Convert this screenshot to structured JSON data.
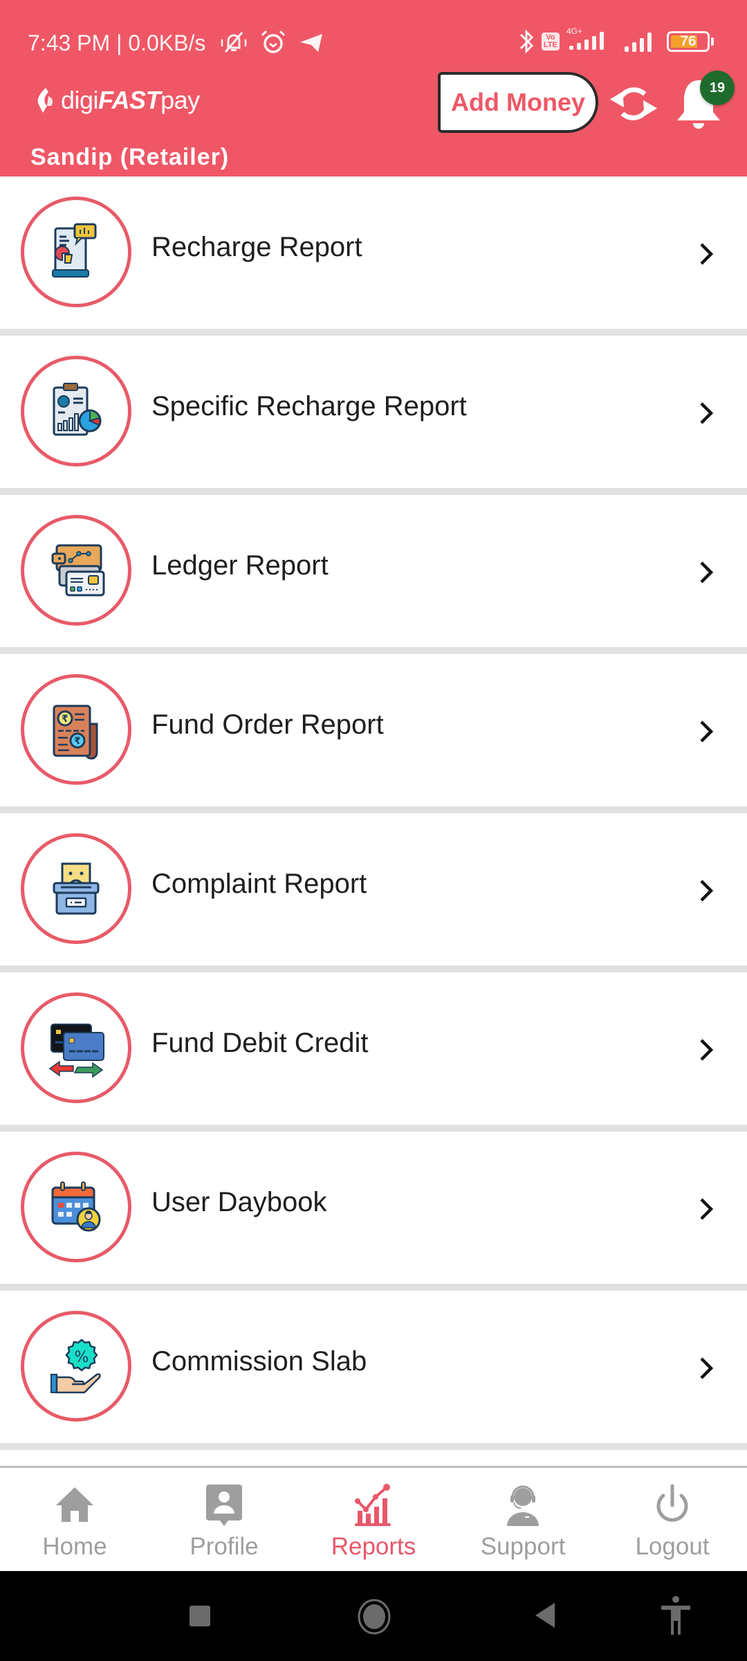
{
  "status_bar": {
    "time": "7:43 PM | 0.0KB/s",
    "left_icons": [
      "mute-vibrate-icon",
      "alarm-icon",
      "telegram-icon"
    ],
    "right_icons": [
      "bluetooth-icon",
      "volte-icon",
      "signal-4g-icon",
      "signal-icon",
      "battery-icon"
    ],
    "volte_label_top": "Vo",
    "volte_label_bottom": "LTE",
    "network_label": "4G+",
    "battery_percent": "76",
    "battery_level": 0.76
  },
  "header": {
    "brand_prefix": "digi",
    "brand_bold": "FAST",
    "brand_suffix": "pay",
    "user_name": "Sandip (Retailer)",
    "add_money_label": "Add Money",
    "refresh_icon": "refresh-icon",
    "notification_icon": "bell-icon",
    "notification_count": "19",
    "colors": {
      "primary": "#ef5766",
      "badge": "#1f6b2c"
    }
  },
  "reports": [
    {
      "label": "Recharge Report",
      "icon": "recharge-report-icon"
    },
    {
      "label": "Specific Recharge Report",
      "icon": "specific-recharge-report-icon"
    },
    {
      "label": "Ledger Report",
      "icon": "ledger-report-icon"
    },
    {
      "label": "Fund Order Report",
      "icon": "fund-order-report-icon"
    },
    {
      "label": "Complaint Report",
      "icon": "complaint-report-icon"
    },
    {
      "label": "Fund Debit Credit",
      "icon": "fund-debit-credit-icon"
    },
    {
      "label": "User Daybook",
      "icon": "user-daybook-icon"
    },
    {
      "label": "Commission Slab",
      "icon": "commission-slab-icon"
    }
  ],
  "bottom_nav": {
    "active": "Reports",
    "items": [
      {
        "label": "Home",
        "icon": "home-icon"
      },
      {
        "label": "Profile",
        "icon": "profile-icon"
      },
      {
        "label": "Reports",
        "icon": "reports-icon"
      },
      {
        "label": "Support",
        "icon": "support-icon"
      },
      {
        "label": "Logout",
        "icon": "power-icon"
      }
    ],
    "colors": {
      "active": "#e8576a",
      "inactive": "#9e9e9e"
    }
  },
  "system_nav": [
    "recents-button",
    "home-button",
    "back-button",
    "accessibility-button"
  ]
}
